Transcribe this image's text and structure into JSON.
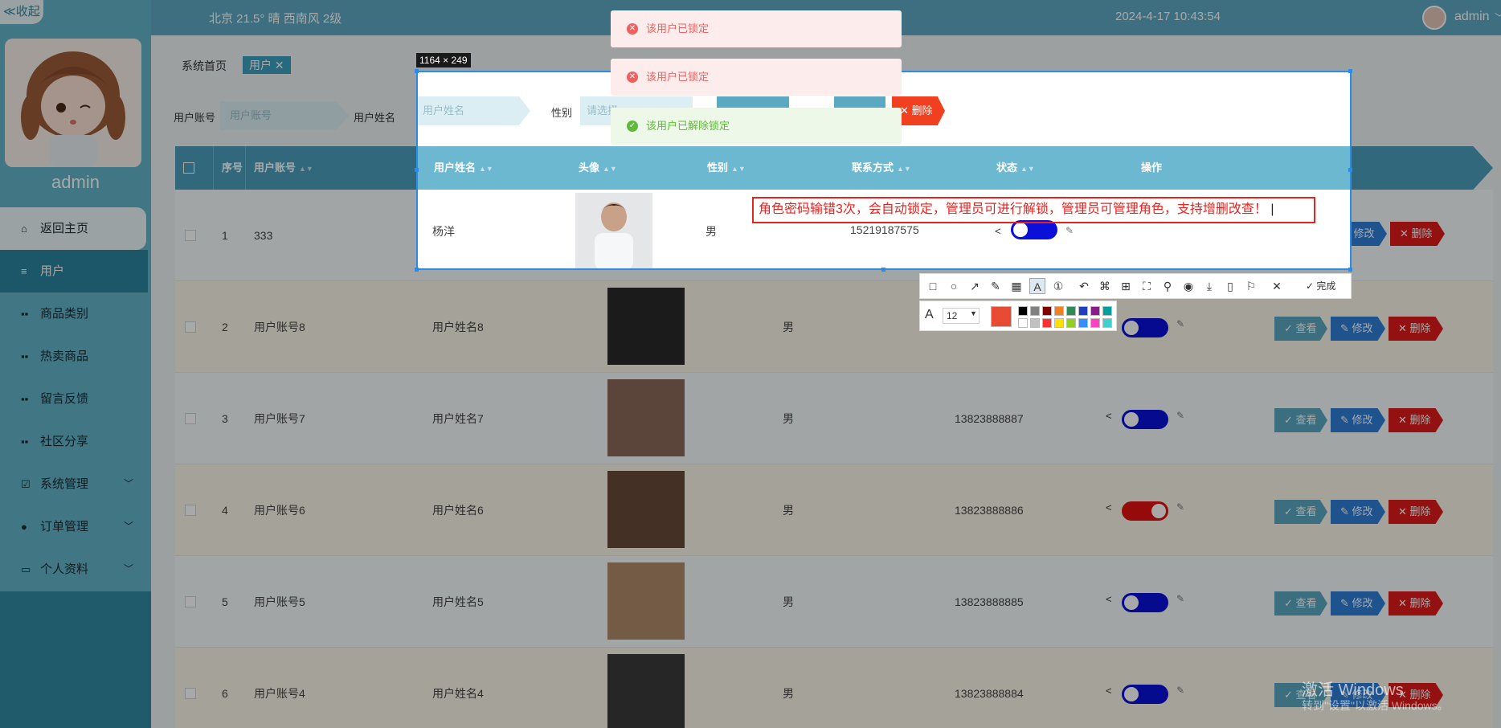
{
  "sidebar": {
    "collapse_label": "≪收起",
    "admin_name": "admin",
    "items": [
      {
        "label": "返回主页",
        "icon": "home-icon"
      },
      {
        "label": "用户",
        "icon": "list-icon"
      },
      {
        "label": "商品类别",
        "icon": "grid-icon"
      },
      {
        "label": "热卖商品",
        "icon": "grid-icon"
      },
      {
        "label": "留言反馈",
        "icon": "grid-icon"
      },
      {
        "label": "社区分享",
        "icon": "grid-icon"
      },
      {
        "label": "系统管理",
        "icon": "check-icon"
      },
      {
        "label": "订单管理",
        "icon": "user-icon"
      },
      {
        "label": "个人资料",
        "icon": "card-icon"
      }
    ]
  },
  "header": {
    "weather": "北京  21.5°  晴  西南风  2级",
    "datetime": "2024-4-17 10:43:54",
    "user": "admin"
  },
  "breadcrumb": {
    "home": "系统首页",
    "tab": "用户 ✕"
  },
  "search": {
    "account_label": "用户账号",
    "account_placeholder": "用户账号",
    "name_label": "用户姓名",
    "name_placeholder": "用户姓名",
    "gender_label": "性别",
    "gender_placeholder": "请选择",
    "delete_label": "删除"
  },
  "table": {
    "headers": [
      "序号",
      "用户账号",
      "用户姓名",
      "头像",
      "性别",
      "联系方式",
      "状态",
      "操作"
    ],
    "rows": [
      {
        "no": "1",
        "account": "333",
        "name": "杨洋",
        "gender": "男",
        "phone": "15219187575",
        "locked": false
      },
      {
        "no": "2",
        "account": "用户账号8",
        "name": "用户姓名8",
        "gender": "男",
        "phone": "",
        "locked": false
      },
      {
        "no": "3",
        "account": "用户账号7",
        "name": "用户姓名7",
        "gender": "男",
        "phone": "13823888887",
        "locked": false
      },
      {
        "no": "4",
        "account": "用户账号6",
        "name": "用户姓名6",
        "gender": "男",
        "phone": "13823888886",
        "locked": true
      },
      {
        "no": "5",
        "account": "用户账号5",
        "name": "用户姓名5",
        "gender": "男",
        "phone": "13823888885",
        "locked": false
      },
      {
        "no": "6",
        "account": "用户账号4",
        "name": "用户姓名4",
        "gender": "男",
        "phone": "13823888884",
        "locked": false
      }
    ],
    "actions": {
      "view": "查看",
      "edit": "修改",
      "delete": "删除"
    }
  },
  "screenshot_tool": {
    "size_label": "1164 × 249",
    "annotation": "角色密码输错3次，会自动锁定，管理员可进行解锁，管理员可管理角色，支持增删改查！",
    "done_label": "完成",
    "font_size": "12",
    "current_color": "#e84a33",
    "swatches_top": [
      "#000000",
      "#808080",
      "#800000",
      "#f08020",
      "#2e8b57",
      "#1e40c0",
      "#8b1a8b",
      "#00a0a0"
    ],
    "swatches_bottom": [
      "#ffffff",
      "#c0c0c0",
      "#ff3030",
      "#ffe000",
      "#90d020",
      "#3090ff",
      "#ff40c0",
      "#40d0d0"
    ]
  },
  "toasts": [
    {
      "text": "该用户已锁定",
      "type": "error"
    },
    {
      "text": "该用户已锁定",
      "type": "error"
    },
    {
      "text": "该用户已解除锁定",
      "type": "success"
    }
  ],
  "watermark": {
    "line1": "激活 Windows",
    "line2": "转到\"设置\"以激活 Windows。"
  }
}
